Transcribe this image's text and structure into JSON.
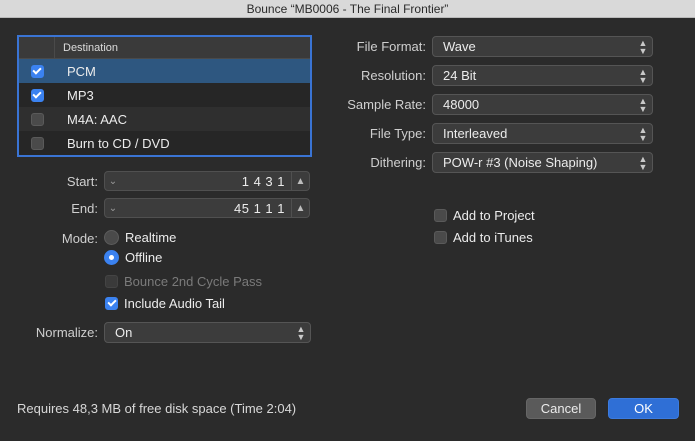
{
  "window": {
    "title": "Bounce “MB0006 - The Final Frontier”"
  },
  "destination": {
    "header": "Destination",
    "items": [
      {
        "label": "PCM",
        "checked": true
      },
      {
        "label": "MP3",
        "checked": true
      },
      {
        "label": "M4A: AAC",
        "checked": false
      },
      {
        "label": "Burn to CD / DVD",
        "checked": false
      }
    ]
  },
  "range": {
    "start_label": "Start:",
    "start_value": "1 4 3     1",
    "end_label": "End:",
    "end_value": "45 1 1     1"
  },
  "mode": {
    "label": "Mode:",
    "realtime": "Realtime",
    "offline": "Offline",
    "selected": "Offline",
    "bounce_2nd_cycle": "Bounce 2nd Cycle Pass",
    "include_audio_tail": "Include Audio Tail"
  },
  "normalize": {
    "label": "Normalize:",
    "value": "On"
  },
  "settings": {
    "file_format_label": "File Format:",
    "file_format": "Wave",
    "resolution_label": "Resolution:",
    "resolution": "24 Bit",
    "sample_rate_label": "Sample Rate:",
    "sample_rate": "48000",
    "file_type_label": "File Type:",
    "file_type": "Interleaved",
    "dithering_label": "Dithering:",
    "dithering": "POW-r #3 (Noise Shaping)"
  },
  "options": {
    "add_to_project": "Add to Project",
    "add_to_itunes": "Add to iTunes"
  },
  "status": "Requires 48,3 MB of free disk space  (Time 2:04)",
  "buttons": {
    "cancel": "Cancel",
    "ok": "OK"
  },
  "colors": {
    "accent": "#3b82f0",
    "selection": "#2e5780"
  }
}
